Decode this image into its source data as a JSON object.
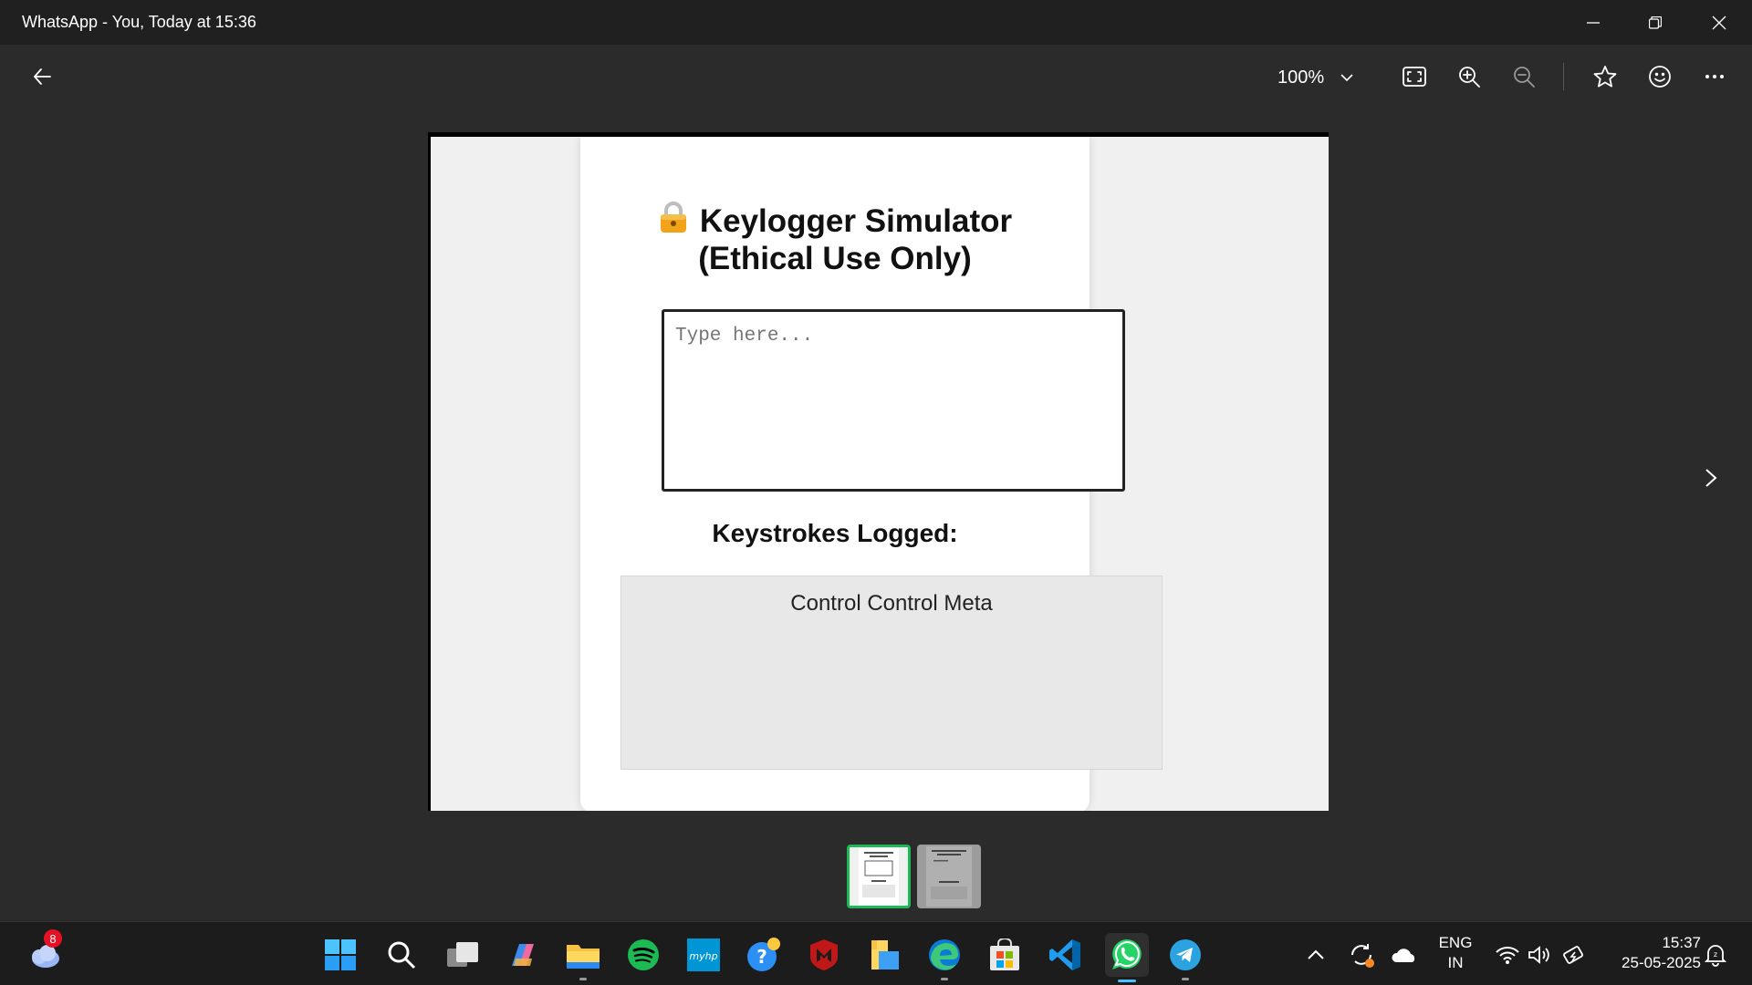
{
  "window": {
    "title": "WhatsApp - You, Today at 15:36"
  },
  "toolbar": {
    "zoom_level": "100%"
  },
  "image": {
    "heading": "Keylogger Simulator (Ethical Use Only)",
    "textarea_placeholder": "Type here...",
    "log_heading": "Keystrokes Logged:",
    "log_content": "Control Control Meta"
  },
  "taskbar": {
    "weather_badge": "8",
    "apps": [
      "start-icon",
      "search-icon",
      "task-view-icon",
      "copilot-icon",
      "file-explorer-icon",
      "spotify-icon",
      "myhp-icon",
      "help-icon",
      "mcafee-icon",
      "files-icon",
      "edge-icon",
      "store-icon",
      "vscode-icon",
      "whatsapp-icon",
      "telegram-icon"
    ],
    "language": "ENG",
    "region": "IN",
    "time": "15:37",
    "date": "25-05-2025"
  },
  "colors": {
    "background": "#2b2b2b",
    "titlebar": "#202020",
    "taskbar": "#1c1c1c",
    "accent_green": "#1db954",
    "log_box": "#e8e8e8"
  }
}
